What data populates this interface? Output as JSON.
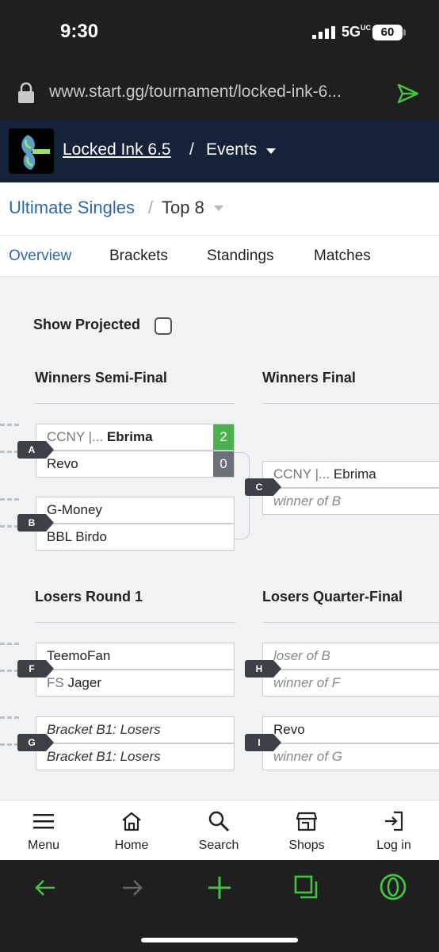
{
  "status": {
    "time": "9:30",
    "network": "5G",
    "network_sup": "UC",
    "battery": "60"
  },
  "browser": {
    "url": "www.start.gg/tournament/locked-ink-6..."
  },
  "header": {
    "tournament": "Locked Ink 6.5",
    "separator": "/",
    "menu_label": "Events"
  },
  "event": {
    "name": "Ultimate Singles",
    "separator": "/",
    "phase": "Top 8"
  },
  "tabs": [
    {
      "label": "Overview"
    },
    {
      "label": "Brackets"
    },
    {
      "label": "Standings"
    },
    {
      "label": "Matches"
    }
  ],
  "bracket": {
    "show_projected_label": "Show Projected",
    "rounds": {
      "winners_semi": "Winners Semi-Final",
      "winners_final": "Winners Final",
      "losers_r1": "Losers Round 1",
      "losers_qf": "Losers Quarter-Final"
    },
    "sets": {
      "A": {
        "id": "A",
        "p1_prefix": "CCNY |...",
        "p1_name": "Ebrima",
        "p1_score": "2",
        "p2_name": "Revo",
        "p2_score": "0"
      },
      "B": {
        "id": "B",
        "p1_name": "G-Money",
        "p2_name": "BBL Birdo"
      },
      "C": {
        "id": "C",
        "p1_prefix": "CCNY |...",
        "p1_name": "Ebrima",
        "p2_name": "winner of B"
      },
      "F": {
        "id": "F",
        "p1_name": "TeemoFan",
        "p2_prefix": "FS",
        "p2_name": "Jager"
      },
      "G": {
        "id": "G",
        "p1_name": "Bracket B1: Losers",
        "p2_name": "Bracket B1: Losers"
      },
      "H": {
        "id": "H",
        "p1_name": "loser of B",
        "p2_name": "winner of F"
      },
      "I": {
        "id": "I",
        "p1_name": "Revo",
        "p2_name": "winner of G"
      }
    }
  },
  "bottom_nav": [
    {
      "label": "Menu"
    },
    {
      "label": "Home"
    },
    {
      "label": "Search"
    },
    {
      "label": "Shops"
    },
    {
      "label": "Log in"
    }
  ],
  "colors": {
    "header_bg": "#16213a",
    "link": "#2d6aa3",
    "win": "#4caf50",
    "lose": "#6b7178",
    "browser_accent": "#43c33f"
  }
}
